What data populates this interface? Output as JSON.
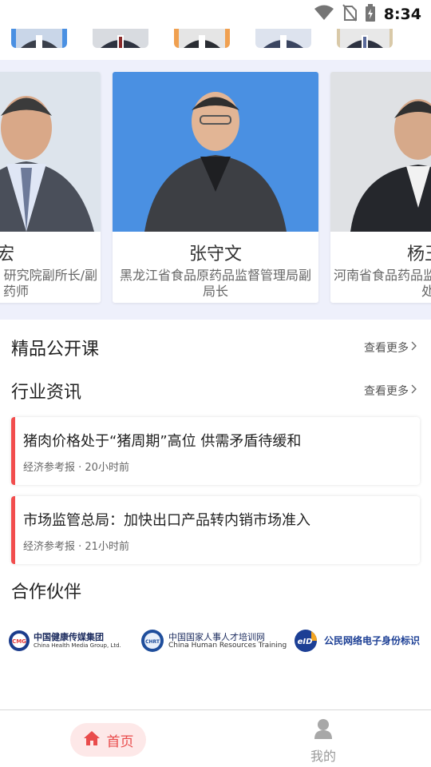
{
  "status_bar": {
    "time": "8:34",
    "icons": [
      "wifi-icon",
      "no-sim-icon",
      "battery-charging-icon"
    ]
  },
  "avatar_strip": {
    "items": [
      "avatar-1",
      "avatar-2",
      "avatar-3",
      "avatar-4",
      "avatar-5"
    ]
  },
  "experts": {
    "cards": [
      {
        "name": "宏",
        "title_line1": "研究院副所长/副",
        "title_line2": "药师"
      },
      {
        "name": "张守文",
        "title_line1": "黑龙江省食品原药品监督管理局副",
        "title_line2": "局长"
      },
      {
        "name": "杨王",
        "title_line1": "河南省食品药品监",
        "title_line2": "处"
      }
    ]
  },
  "sections": {
    "courses": {
      "title": "精品公开课",
      "more": "查看更多"
    },
    "news": {
      "title": "行业资讯",
      "more": "查看更多"
    },
    "partners": {
      "title": "合作伙伴"
    }
  },
  "news": [
    {
      "title": "猪肉价格处于“猪周期”高位 供需矛盾待缓和",
      "meta": "经济参考报 · 20小时前"
    },
    {
      "title": "市场监管总局：加快出口产品转内销市场准入",
      "meta": "经济参考报 · 21小时前"
    }
  ],
  "partners": [
    {
      "name": "中国健康传媒集团",
      "sub": "China Health Media Group, Ltd.",
      "badge": "CMG"
    },
    {
      "name": "中国国家人事人才培训网",
      "sub": "China Human Resources Training",
      "badge": "CHRT"
    },
    {
      "name": "公民网络电子身份标识",
      "sub": "",
      "badge": "eID"
    }
  ],
  "tabs": {
    "home": "首页",
    "mine": "我的"
  },
  "colors": {
    "accent": "#e94b4b",
    "carousel_bg": "#eef0fb",
    "photo_bg": "#4a90e2"
  }
}
